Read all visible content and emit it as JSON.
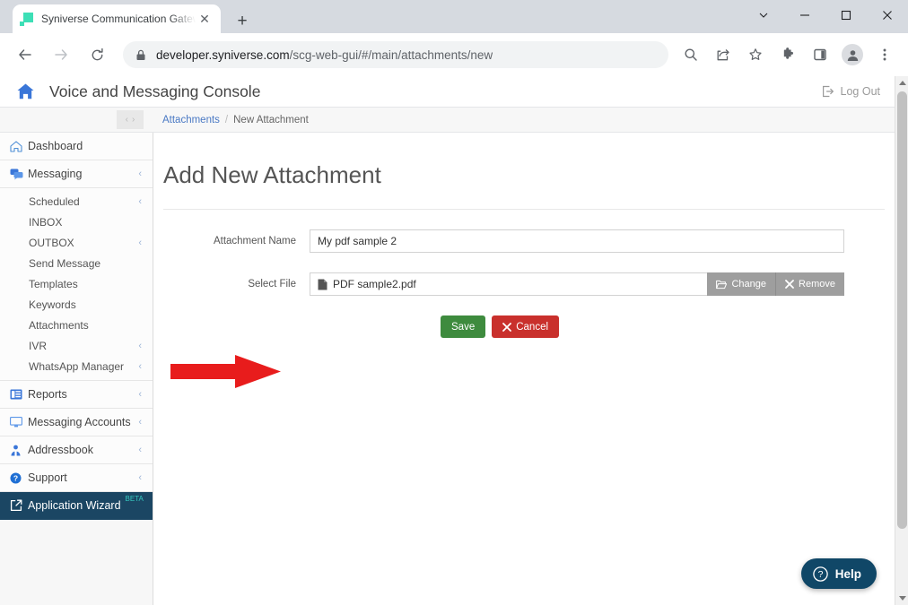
{
  "browser": {
    "tab": {
      "title": "Syniverse Communication Gatew",
      "favicon_name": "syniverse-favicon",
      "close_label": "✕"
    },
    "new_tab_label": "+",
    "window_controls": {
      "tab_search": "⌄",
      "minimize": "—",
      "maximize": "☐",
      "close": "✕"
    },
    "omnibox": {
      "lock_icon": "lock-icon",
      "domain": "developer.syniverse.com",
      "path": "/scg-web-gui/#/main/attachments/new",
      "full_url": "developer.syniverse.com/scg-web-gui/#/main/attachments/new"
    },
    "toolbar_icons": [
      "search-icon",
      "share-icon",
      "bookmark-star-icon",
      "extensions-puzzle-icon",
      "side-panel-icon",
      "profile-avatar-icon",
      "three-dot-menu-icon"
    ],
    "nav": {
      "back": "back-arrow-icon",
      "forward": "forward-arrow-icon",
      "reload": "reload-icon"
    }
  },
  "header": {
    "home_icon": "home-icon",
    "title": "Voice and Messaging Console",
    "logout_label": "Log Out"
  },
  "breadcrumb": {
    "collapse_prev": "‹",
    "collapse_next": "›",
    "parent": "Attachments",
    "separator": "/",
    "current": "New Attachment"
  },
  "sidebar": {
    "items": [
      {
        "label": "Dashboard",
        "icon": "home-outline-icon",
        "chevron": ""
      },
      {
        "label": "Messaging",
        "icon": "chat-bubbles-icon",
        "chevron": "‹"
      },
      {
        "label": "Reports",
        "icon": "reports-icon",
        "chevron": "‹"
      },
      {
        "label": "Messaging Accounts",
        "icon": "monitor-icon",
        "chevron": "‹"
      },
      {
        "label": "Addressbook",
        "icon": "addressbook-icon",
        "chevron": "‹"
      },
      {
        "label": "Support",
        "icon": "question-circle-icon",
        "chevron": "‹"
      },
      {
        "label": "Application Wizard",
        "icon": "external-link-icon",
        "chevron": "",
        "badge": "BETA"
      }
    ],
    "messaging_subitems": [
      {
        "label": "Scheduled",
        "chevron": "‹"
      },
      {
        "label": "INBOX",
        "chevron": ""
      },
      {
        "label": "OUTBOX",
        "chevron": "‹"
      },
      {
        "label": "Send Message",
        "chevron": ""
      },
      {
        "label": "Templates",
        "chevron": ""
      },
      {
        "label": "Keywords",
        "chevron": ""
      },
      {
        "label": "Attachments",
        "chevron": ""
      },
      {
        "label": "IVR",
        "chevron": "‹"
      },
      {
        "label": "WhatsApp Manager",
        "chevron": "‹"
      }
    ]
  },
  "main": {
    "page_title": "Add New Attachment",
    "fields": {
      "attachment_name": {
        "label": "Attachment Name",
        "value": "My pdf sample 2",
        "placeholder": ""
      },
      "select_file": {
        "label": "Select File",
        "file_name": "PDF sample2.pdf",
        "file_icon": "file-icon",
        "change_label": "Change",
        "change_icon": "folder-open-icon",
        "remove_label": "Remove",
        "remove_icon": "x-icon"
      }
    },
    "buttons": {
      "save_label": "Save",
      "cancel_label": "Cancel",
      "cancel_icon": "x-icon"
    },
    "annotation": {
      "name": "red-arrow-annotation",
      "color": "#e81c1c",
      "points_at": "Save"
    }
  },
  "help": {
    "label": "Help",
    "icon": "question-circle-icon"
  },
  "colors": {
    "wizard_bg": "#1b4663",
    "beta_badge": "#35c9c0",
    "save_green": "#3e8b3e",
    "cancel_red": "#c9302c",
    "help_navy": "#104767",
    "link_blue": "#4a79c4",
    "arrow_red": "#e81c1c"
  }
}
